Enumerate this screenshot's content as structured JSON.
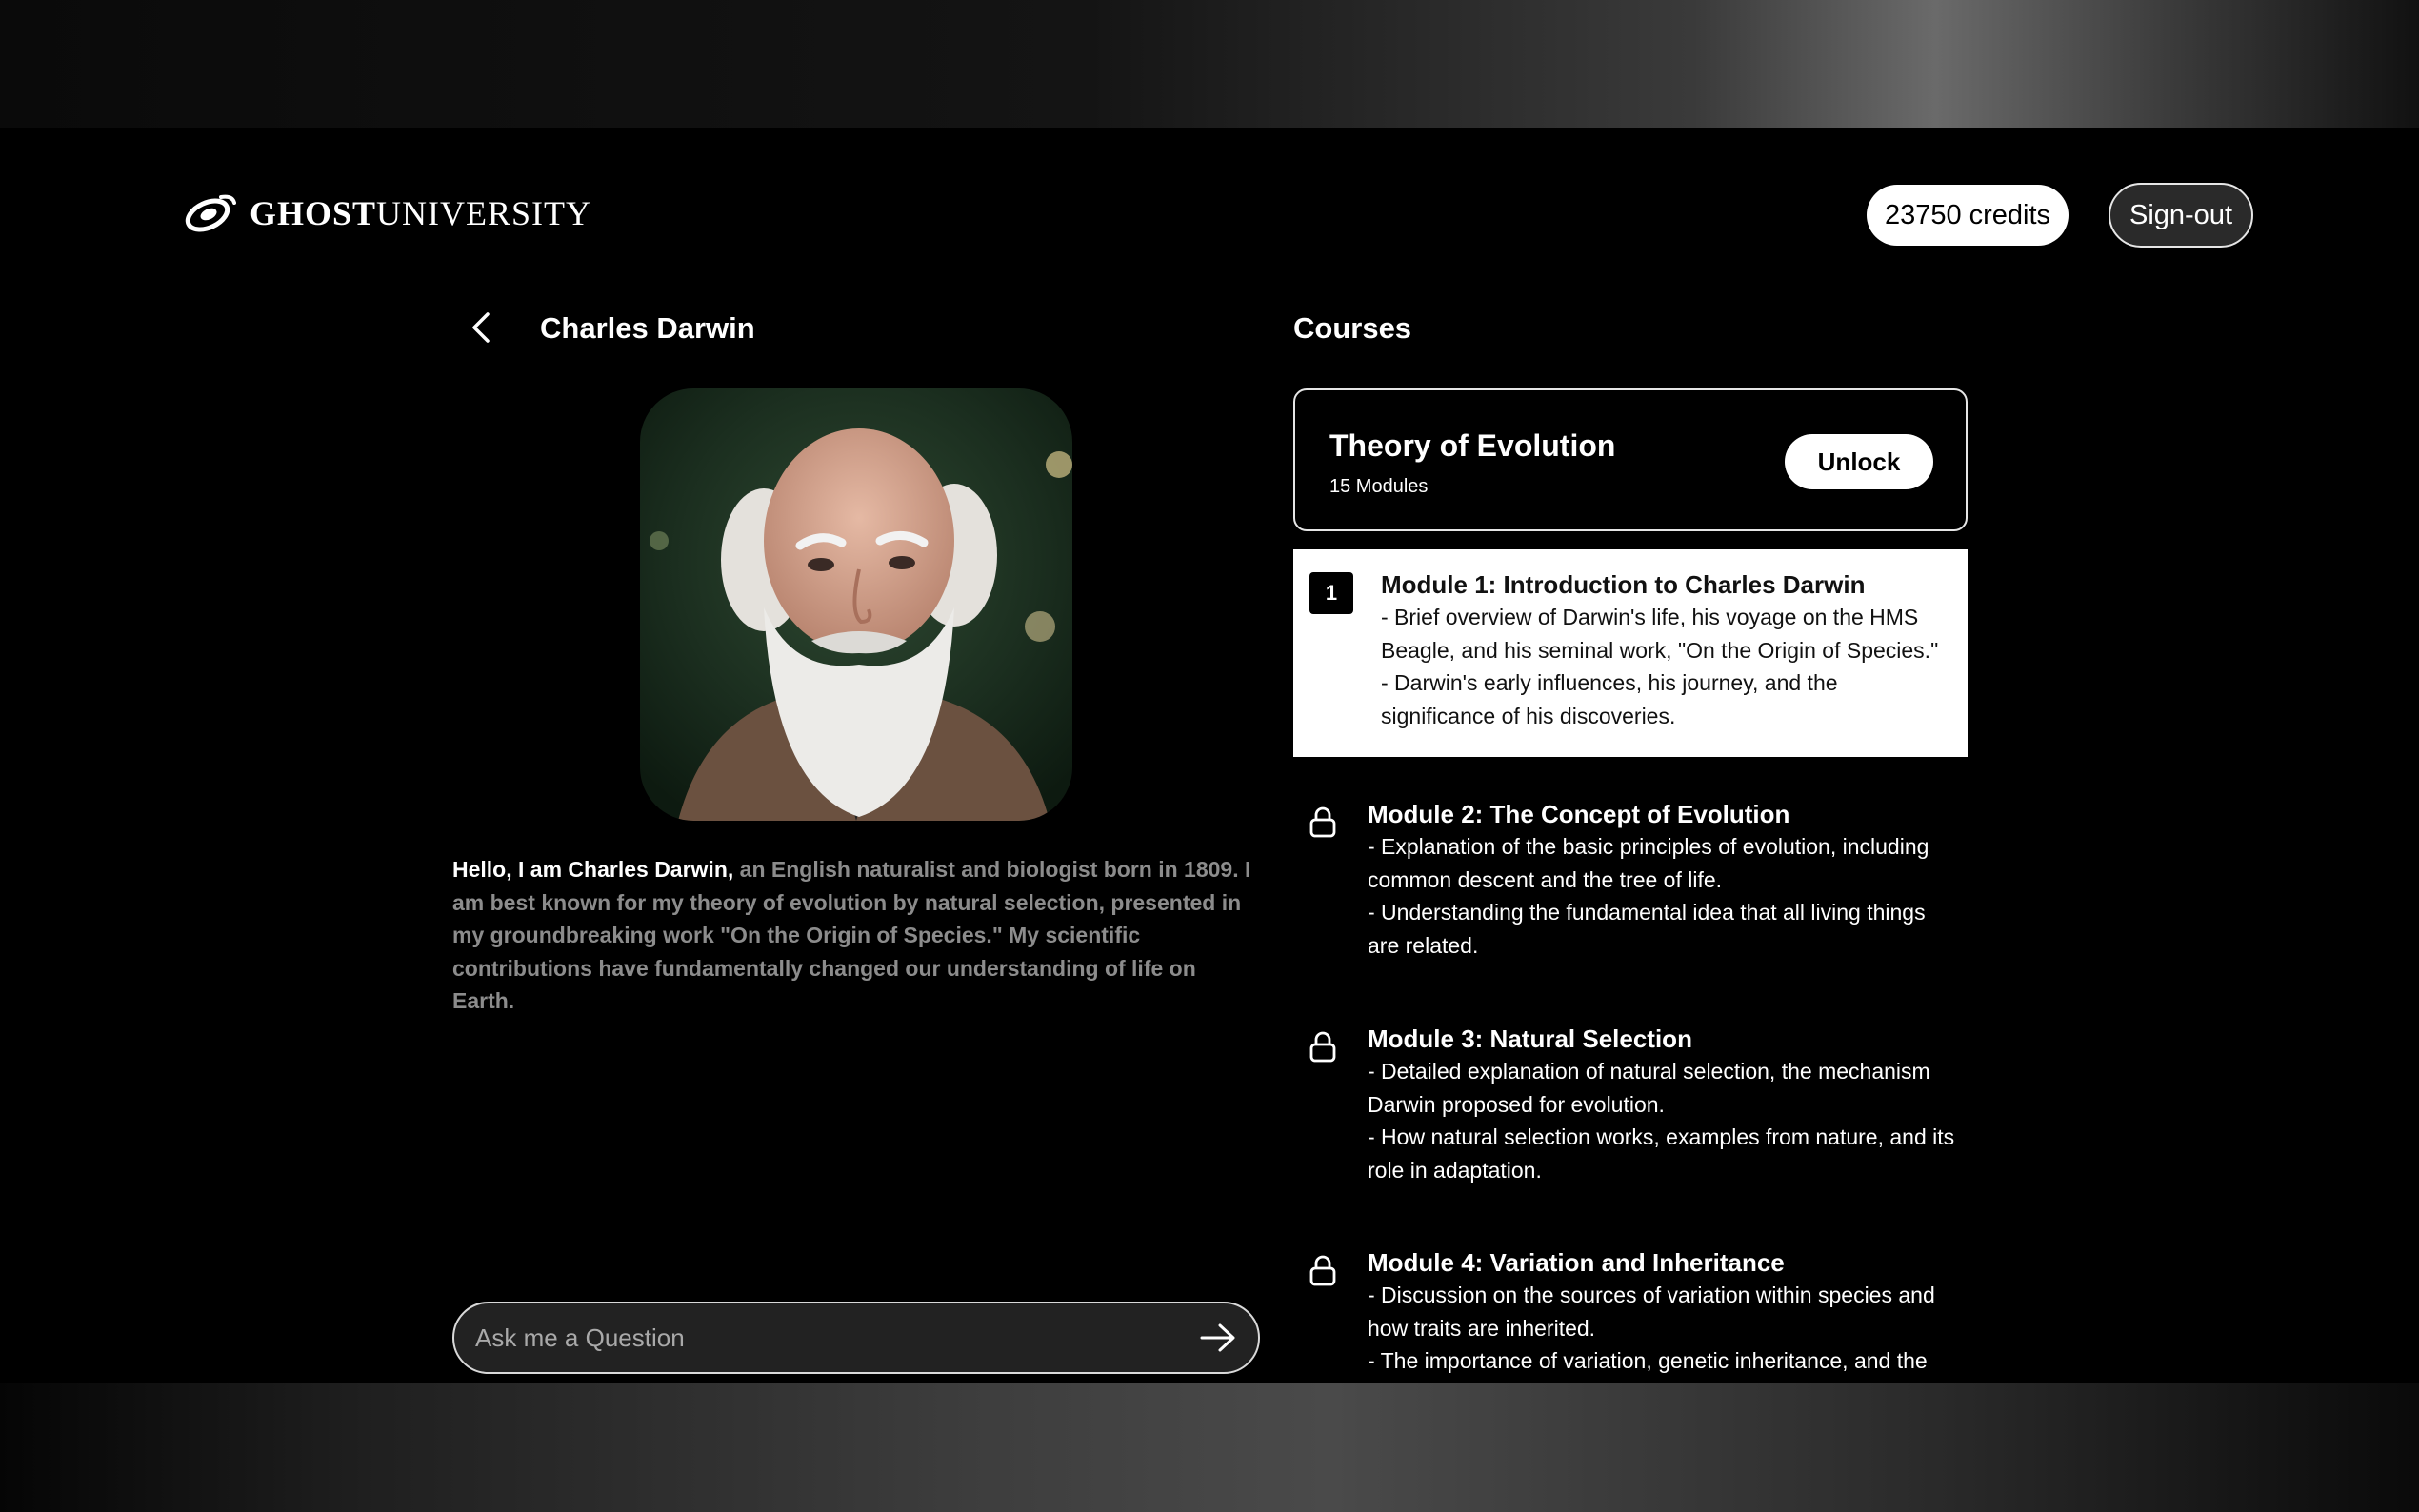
{
  "header": {
    "logo_bold": "GHOST",
    "logo_regular": "UNIVERSITY",
    "credits_label": "23750 credits",
    "signout_label": "Sign-out"
  },
  "profile": {
    "name": "Charles Darwin",
    "bio_intro": "Hello, I am Charles Darwin,",
    "bio_rest": " an English naturalist and biologist born in 1809. I am best known for my theory of evolution by natural selection, presented in my groundbreaking work \"On the Origin of Species.\" My scientific contributions have fundamentally changed our understanding of life on Earth."
  },
  "ask": {
    "placeholder": "Ask me a Question"
  },
  "courses": {
    "title": "Courses",
    "course": {
      "title": "Theory of Evolution",
      "modules_count": "15 Modules",
      "unlock_label": "Unlock"
    },
    "modules": [
      {
        "number": "1",
        "title": "Module 1: Introduction to Charles Darwin",
        "line1": "- Brief overview of Darwin's life, his voyage on the HMS Beagle, and his seminal work, \"On the Origin of Species.\"",
        "line2": "- Darwin's early influences, his journey, and the significance of his discoveries."
      },
      {
        "title": "Module 2: The Concept of Evolution",
        "line1": "- Explanation of the basic principles of evolution, including common descent and the tree of life.",
        "line2": "- Understanding the fundamental idea that all living things are related."
      },
      {
        "title": "Module 3: Natural Selection",
        "line1": "- Detailed explanation of natural selection, the mechanism Darwin proposed for evolution.",
        "line2": "- How natural selection works, examples from nature, and its role in adaptation."
      },
      {
        "title": "Module 4: Variation and Inheritance",
        "line1": "- Discussion on the sources of variation within species and how traits are inherited.",
        "line2": "- The importance of variation, genetic inheritance, and the"
      }
    ]
  },
  "icons": {
    "logo": "ghost-swirl-logo-icon",
    "back": "chevron-left-icon",
    "send": "arrow-right-icon",
    "lock": "lock-icon"
  }
}
